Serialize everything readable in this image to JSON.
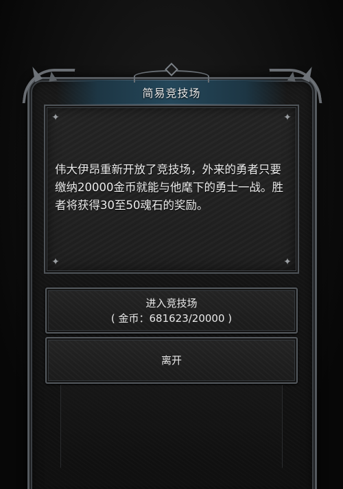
{
  "dialog": {
    "title": "简易竞技场",
    "message": "伟大伊昂重新开放了竞技场，外来的勇者只要缴纳20000金币就能与他麾下的勇士一战。胜者将获得30至50魂石的奖励。"
  },
  "buttons": {
    "enter_label": "进入竞技场",
    "enter_cost": "( 金币：681623/20000 )",
    "leave_label": "离开"
  },
  "colors": {
    "title_bar": "#24475a",
    "frame": "#555a5f",
    "panel": "#222222",
    "text": "#ececec"
  },
  "icons": {
    "corner_ornament": "sparkle-icon"
  }
}
